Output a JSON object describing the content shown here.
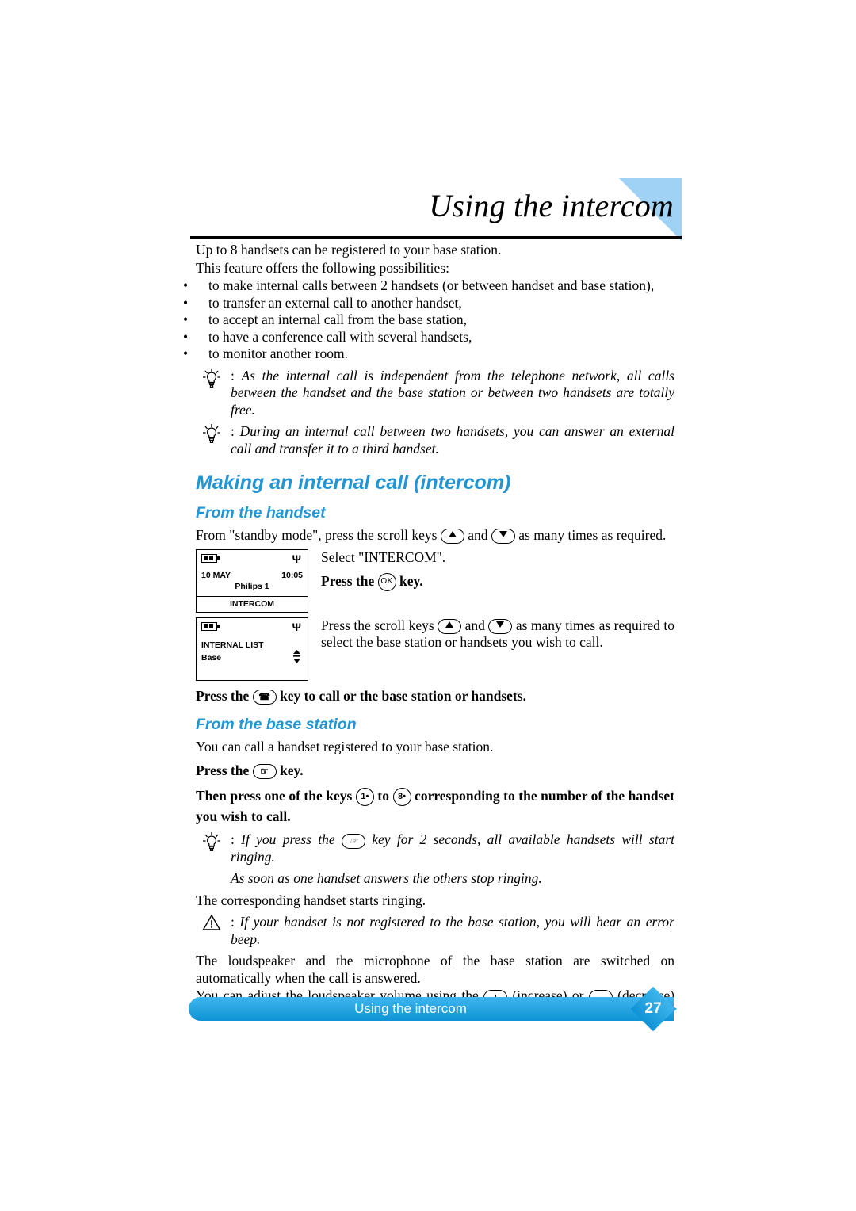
{
  "header": {
    "title": "Using the intercom"
  },
  "intro": {
    "line1": "Up to 8 handsets can be registered to your base station.",
    "line2": "This feature offers the following possibilities:",
    "bullets": [
      "to make internal calls between 2 handsets (or between handset and base station),",
      "to transfer an external call to another handset,",
      "to accept an internal call from the base station,",
      "to have a conference call with several handsets,",
      "to monitor another room."
    ]
  },
  "tips": [
    {
      "icon": "lightbulb-icon",
      "text": "As the internal call is independent from the telephone network, all calls between the handset and the base station or between two handsets are totally free."
    },
    {
      "icon": "lightbulb-icon",
      "text": "During an internal call between two handsets, you can answer an external call and transfer it to a third handset."
    }
  ],
  "section1": {
    "heading": "Making an internal call (intercom)",
    "sub1": {
      "heading": "From the handset",
      "para1_a": "From \"standby mode\", press the scroll keys",
      "para1_b": "and",
      "para1_c": "as many times as required.",
      "para2": "Select \"INTERCOM\".",
      "press_ok_a": "Press the",
      "press_ok_b": "key.",
      "para3_a": "Press the scroll keys",
      "para3_b": "and",
      "para3_c": "as many times as required to select the base station or handsets you wish to call.",
      "press_call_a": "Press the",
      "press_call_b": "key to call or the base station or handsets.",
      "lcd1": {
        "date": "10 MAY",
        "time": "10:05",
        "name": "Philips 1",
        "softkey": "INTERCOM",
        "battery_icon": "battery-icon",
        "antenna_icon": "antenna-icon"
      },
      "lcd2": {
        "title": "INTERNAL LIST",
        "item": "Base",
        "battery_icon": "battery-icon",
        "antenna_icon": "antenna-icon",
        "scroll_icon": "up-down-arrows-icon"
      }
    },
    "sub2": {
      "heading": "From the base station",
      "para1": "You can call a handset registered to your base station.",
      "press_spk_a": "Press the",
      "press_spk_b": "key.",
      "press_keys_a": "Then press one of the keys",
      "press_keys_b": "to",
      "press_keys_c": "corresponding to the number of the handset you wish to call.",
      "key1_label": "1",
      "key8_label": "8",
      "tip3_a": "If you press the",
      "tip3_b": "key for 2 seconds, all available handsets will start ringing.",
      "tip3_note": "As soon as one handset answers the others stop ringing.",
      "para_ringing": "The corresponding handset starts ringing.",
      "warning": "If your handset is not registered to the base station, you will hear an error beep.",
      "para_loudspeaker": "The loudspeaker and the microphone of the base station are switched on automatically when the call is answered.",
      "para_volume_a": "You can adjust the loudspeaker volume using the",
      "para_volume_b": "(increase) or",
      "para_volume_c": "(decrease) keys.",
      "plus_label": "+",
      "minus_label": "–"
    }
  },
  "footer": {
    "title": "Using the intercom",
    "page": "27"
  },
  "colors": {
    "accent_blue": "#2196d6",
    "header_triangle": "#9fd2f5",
    "footer_bar": "#1ba1e2"
  }
}
